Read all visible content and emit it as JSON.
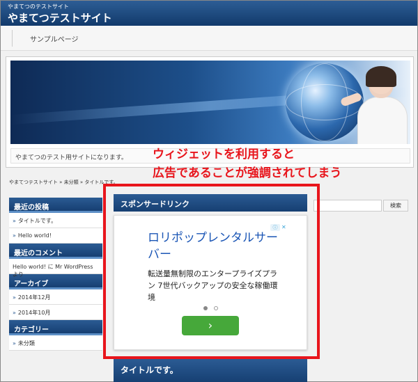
{
  "header": {
    "site_subtitle": "やまてつのテストサイト",
    "site_title": "やまてつテストサイト"
  },
  "nav": {
    "items": [
      "サンプルページ"
    ]
  },
  "hero": {
    "caption": "やまてつのテスト用サイトになります。"
  },
  "breadcrumb": "やまてつテストサイト » 未分類 » タイトルです。",
  "sidebar": {
    "recent_posts": {
      "title": "最近の投稿",
      "items": [
        "タイトルです。",
        "Hello world!"
      ]
    },
    "recent_comments": {
      "title": "最近のコメント",
      "items": [
        "Hello world! に Mr WordPress より"
      ]
    },
    "archives": {
      "title": "アーカイブ",
      "items": [
        "2014年12月",
        "2014年10月"
      ]
    },
    "categories": {
      "title": "カテゴリー",
      "items": [
        "未分類"
      ]
    }
  },
  "search": {
    "button_label": "検索"
  },
  "ad": {
    "title": "スポンサードリンク",
    "headline": "ロリポップレンタルサーバー",
    "body": "転送量無制限のエンタープライズプラン 7世代バックアップの安全な稼働環境",
    "cta": "›",
    "choices_icon": "adchoices-icon",
    "close_icon": "close-icon",
    "cta_color": "#46a83a",
    "headline_color": "#1a55b5"
  },
  "post": {
    "title": "タイトルです。"
  },
  "annotation": {
    "line1": "ウィジェットを利用すると",
    "line2": "広告であることが強調されてしまう",
    "color": "#e8151c"
  }
}
